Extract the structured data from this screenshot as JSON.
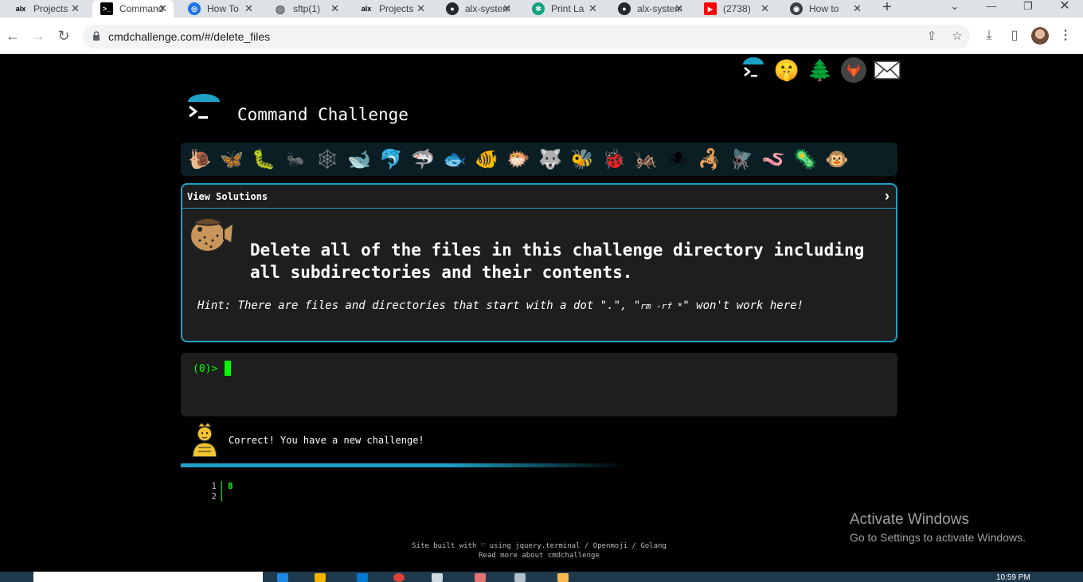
{
  "browser": {
    "tabs": [
      {
        "label": "Projects",
        "favicon": "alx"
      },
      {
        "label": "Command",
        "favicon": "terminal",
        "active": true
      },
      {
        "label": "How To",
        "favicon": "blue-circle"
      },
      {
        "label": "sftp(1)",
        "favicon": "globe"
      },
      {
        "label": "Projects",
        "favicon": "alx"
      },
      {
        "label": "alx-system",
        "favicon": "github"
      },
      {
        "label": "Print La",
        "favicon": "openai"
      },
      {
        "label": "alx-system",
        "favicon": "github"
      },
      {
        "label": "(2738)",
        "favicon": "youtube"
      },
      {
        "label": "How to",
        "favicon": "eye"
      }
    ],
    "url": "cmdchallenge.com/#/delete_files"
  },
  "site": {
    "title": "Command Challenge",
    "view_solutions": "View Solutions",
    "challenge_text": "Delete all of the files in this challenge directory including all subdirectories and their contents.",
    "hint_prefix": "Hint: There are files and directories that start with a dot \".\", \"",
    "hint_code": "rm -rf *",
    "hint_suffix": "\" won't work here!",
    "prompt": "(0)>",
    "result_message": "Correct! You have a new challenge!",
    "output_line_numbers": [
      "1",
      "2"
    ],
    "output_lines": [
      "8",
      ""
    ],
    "footer_line1": "Site built with ♡ using jquery.terminal / Openmoji / Golang",
    "footer_line2": "Read more about cmdchallenge"
  },
  "windows": {
    "activate_title": "Activate Windows",
    "activate_sub": "Go to Settings to activate Windows.",
    "clock": "10:59 PM"
  },
  "colors": {
    "accent": "#1da1c7",
    "prompt_green": "#00ff00",
    "panel_bg": "#1e1e1e"
  },
  "animals": [
    "snail-icon",
    "butterfly-icon",
    "caterpillar-icon",
    "ant-icon",
    "web-icon",
    "whale-icon",
    "dolphin-icon",
    "shark-icon",
    "fish-icon",
    "tropical-fish-icon",
    "pufferfish-icon",
    "wolf-icon",
    "bee-icon",
    "ladybug-icon",
    "cricket-icon",
    "spider-icon",
    "scorpion-icon",
    "fly-icon",
    "worm-icon",
    "microbe-icon",
    "monkey-icon"
  ]
}
